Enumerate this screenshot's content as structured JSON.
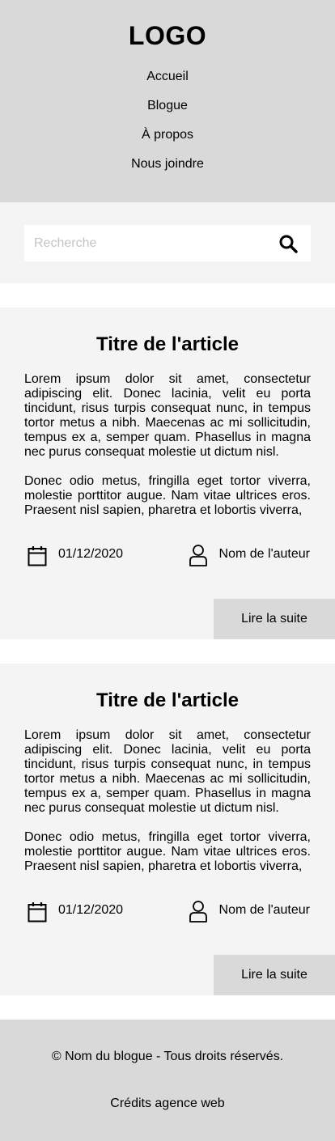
{
  "header": {
    "logo": "LOGO",
    "nav": [
      "Accueil",
      "Blogue",
      "À propos",
      "Nous joindre"
    ]
  },
  "search": {
    "placeholder": "Recherche",
    "icon": "search-icon"
  },
  "articles": [
    {
      "title": "Titre de l'article",
      "paragraphs": [
        "Lorem ipsum dolor sit amet, consectetur adipiscing elit. Donec lacinia, velit eu porta tincidunt, risus turpis consequat nunc, in tempus tortor metus a nibh. Maecenas ac mi sollicitudin, tempus ex a, semper quam. Phasellus in magna nec purus consequat molestie ut dictum nisl.",
        "Donec odio metus, fringilla eget tortor viverra, molestie porttitor augue. Nam vitae ultrices eros. Praesent nisl sapien, pharetra et lobortis viverra,"
      ],
      "date": "01/12/2020",
      "author": "Nom de l'auteur",
      "read_more": "Lire la suite"
    },
    {
      "title": "Titre de l'article",
      "paragraphs": [
        "Lorem ipsum dolor sit amet, consectetur adipiscing elit. Donec lacinia, velit eu porta tincidunt, risus turpis consequat nunc, in tempus tortor metus a nibh. Maecenas ac mi sollicitudin, tempus ex a, semper quam. Phasellus in magna nec purus consequat molestie ut dictum nisl.",
        "Donec odio metus, fringilla eget tortor viverra, molestie porttitor augue. Nam vitae ultrices eros. Praesent nisl sapien, pharetra et lobortis viverra,"
      ],
      "date": "01/12/2020",
      "author": "Nom de l'auteur",
      "read_more": "Lire la suite"
    }
  ],
  "footer": {
    "copyright": "© Nom du blogue - Tous droits réservés.",
    "credits": "Crédits agence web"
  },
  "colors": {
    "header_bg": "#d9d9d9",
    "section_bg": "#f4f4f4",
    "page_bg": "#ffffff",
    "button_bg": "#d9d9d9"
  }
}
